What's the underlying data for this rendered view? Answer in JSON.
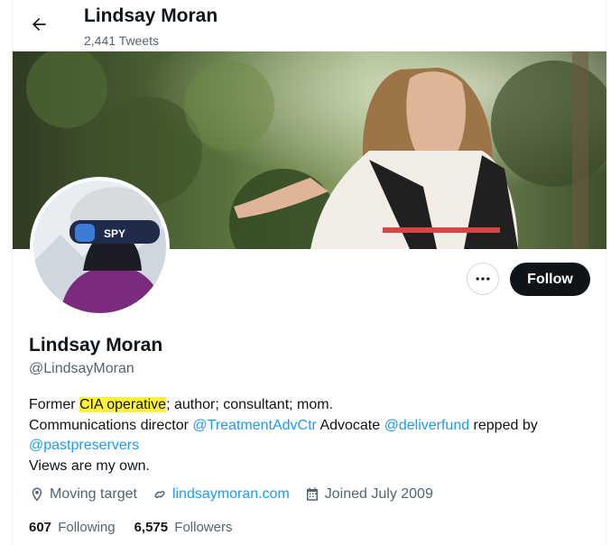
{
  "header": {
    "name": "Lindsay Moran",
    "tweet_count": "2,441 Tweets"
  },
  "actions": {
    "follow_label": "Follow",
    "more_label": "•••"
  },
  "profile": {
    "name": "Lindsay Moran",
    "handle": "@LindsayMoran",
    "bio": {
      "l1_pre": "Former ",
      "l1_highlight": "CIA operative",
      "l1_post": "; author; consultant; mom.",
      "l2_text1": "Communications director ",
      "l2_mention1": "@TreatmentAdvCtr",
      "l2_text2": " Advocate ",
      "l2_mention2": "@deliverfund",
      "l2_text3": " repped by",
      "l3_mention": "@pastpreservers",
      "l4": "Views are my own."
    },
    "location": "Moving target",
    "website": "lindsaymoran.com",
    "joined": "Joined July 2009"
  },
  "stats": {
    "following_count": "607",
    "following_label": "Following",
    "followers_count": "6,575",
    "followers_label": "Followers"
  },
  "icons": {
    "back": "arrow-left-icon",
    "more": "more-dots-icon",
    "location": "location-pin-icon",
    "link": "link-icon",
    "calendar": "calendar-icon"
  },
  "colors": {
    "accent": "#1d9bf0",
    "highlight": "#fff23a",
    "text": "#0f1419",
    "muted": "#536471"
  }
}
